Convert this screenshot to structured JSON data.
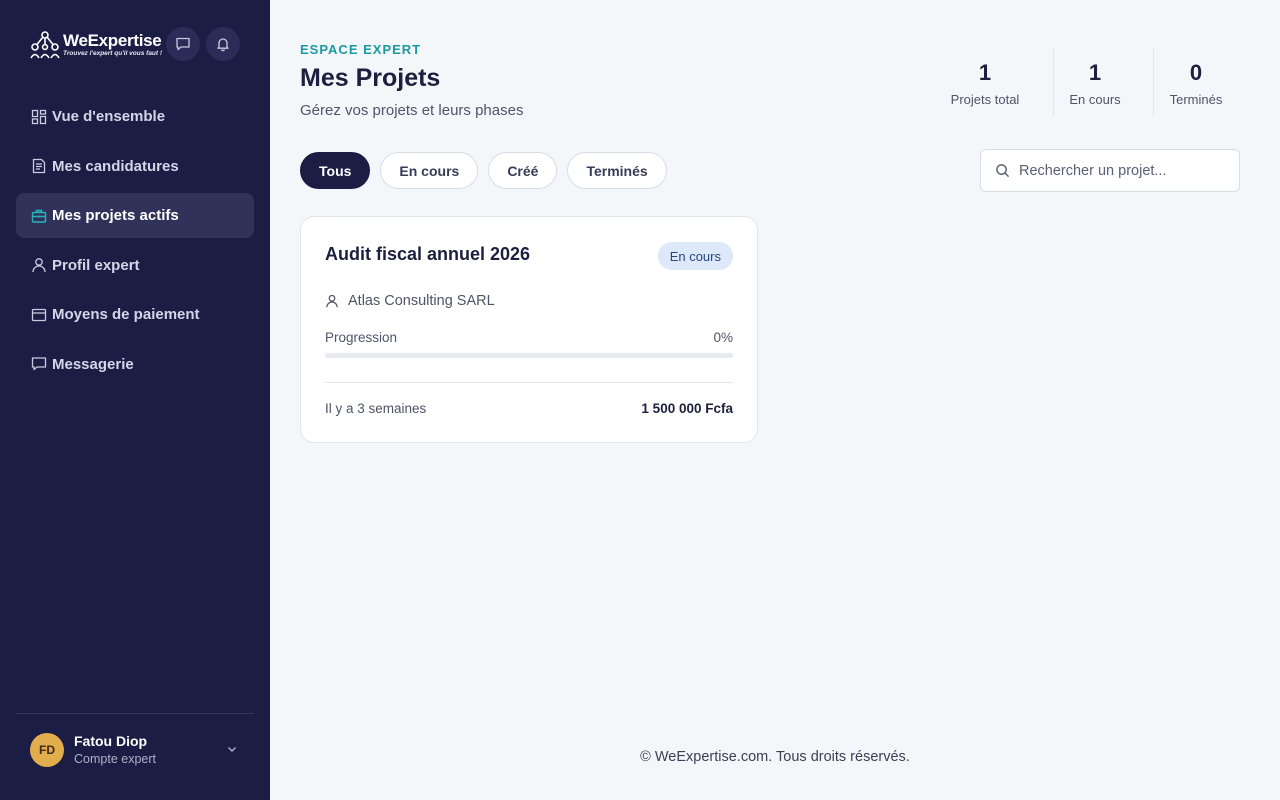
{
  "brand": {
    "name": "WeExpertise",
    "tagline": "Trouvez l'expert qu'il vous faut !"
  },
  "sidebar": {
    "items": [
      {
        "label": "Vue d'ensemble",
        "icon": "dashboard-icon"
      },
      {
        "label": "Mes candidatures",
        "icon": "document-icon"
      },
      {
        "label": "Mes projets actifs",
        "icon": "briefcase-icon",
        "active": true
      },
      {
        "label": "Profil expert",
        "icon": "user-icon"
      },
      {
        "label": "Moyens de paiement",
        "icon": "credit-card-icon"
      },
      {
        "label": "Messagerie",
        "icon": "message-icon"
      }
    ],
    "user": {
      "initials": "FD",
      "name": "Fatou Diop",
      "role": "Compte expert"
    }
  },
  "header": {
    "eyebrow": "ESPACE EXPERT",
    "title": "Mes Projets",
    "subtitle": "Gérez vos projets et leurs phases"
  },
  "stats": [
    {
      "value": "1",
      "label": "Projets total"
    },
    {
      "value": "1",
      "label": "En cours"
    },
    {
      "value": "0",
      "label": "Terminés"
    }
  ],
  "filters": [
    "Tous",
    "En cours",
    "Créé",
    "Terminés"
  ],
  "search": {
    "placeholder": "Rechercher un projet..."
  },
  "projects": [
    {
      "title": "Audit fiscal annuel 2026",
      "status": "En cours",
      "client": "Atlas Consulting SARL",
      "progress_label": "Progression",
      "progress_text": "0%",
      "progress": 0,
      "date": "Il y a 3 semaines",
      "amount": "1 500 000 Fcfa"
    }
  ],
  "footer": "© WeExpertise.com. Tous droits réservés.",
  "colors": {
    "sidebar": "#1c1d45",
    "accent": "#1a9aa2",
    "badge": "#dde8fb",
    "avatar": "#e2ad4c"
  }
}
